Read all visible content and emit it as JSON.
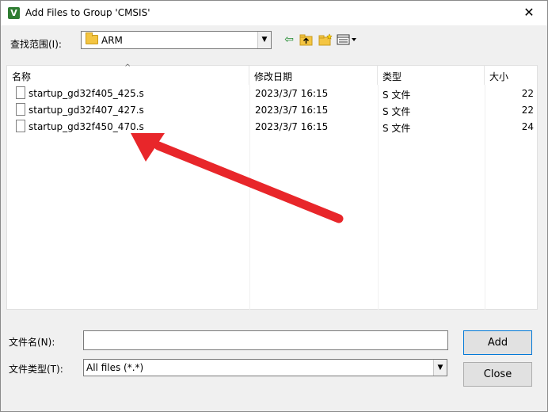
{
  "window": {
    "title": "Add Files to Group 'CMSIS'",
    "app_icon_glyph": "V",
    "close_glyph": "✕"
  },
  "lookin": {
    "label": "查找范围(I):",
    "value": "ARM"
  },
  "toolbar": {
    "icons": [
      "back-arrow-icon",
      "up-folder-icon",
      "new-folder-icon",
      "view-menu-icon"
    ]
  },
  "filelist": {
    "columns": [
      "名称",
      "修改日期",
      "类型",
      "大小"
    ],
    "rows": [
      {
        "name": "startup_gd32f405_425.s",
        "date": "2023/3/7 16:15",
        "type": "S 文件",
        "size": "22"
      },
      {
        "name": "startup_gd32f407_427.s",
        "date": "2023/3/7 16:15",
        "type": "S 文件",
        "size": "22"
      },
      {
        "name": "startup_gd32f450_470.s",
        "date": "2023/3/7 16:15",
        "type": "S 文件",
        "size": "24"
      }
    ]
  },
  "filename": {
    "label": "文件名(N):",
    "value": ""
  },
  "filetype": {
    "label": "文件类型(T):",
    "value": "All files (*.*)"
  },
  "buttons": {
    "add": "Add",
    "close": "Close"
  },
  "annotation": {
    "color": "#e8262a"
  }
}
